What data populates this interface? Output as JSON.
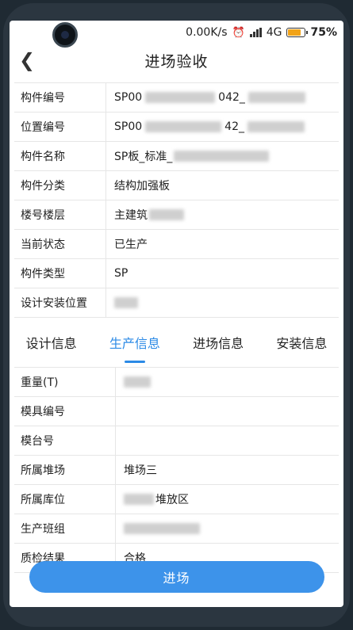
{
  "status": {
    "speed": "0.00K/s",
    "network": "4G",
    "battery": "75%"
  },
  "header": {
    "title": "进场验收"
  },
  "info_rows": [
    {
      "label": "构件编号",
      "value_prefix": "SP00",
      "value_mid": "042_"
    },
    {
      "label": "位置编号",
      "value_prefix": "SP00",
      "value_mid": "42_"
    },
    {
      "label": "构件名称",
      "value_prefix": "SP板_标准_"
    },
    {
      "label": "构件分类",
      "value_prefix": "结构加强板"
    },
    {
      "label": "楼号楼层",
      "value_prefix": "主建筑"
    },
    {
      "label": "当前状态",
      "value_prefix": "已生产"
    },
    {
      "label": "构件类型",
      "value_prefix": "SP"
    },
    {
      "label": "设计安装位置",
      "value_prefix": ""
    }
  ],
  "tabs": [
    "设计信息",
    "生产信息",
    "进场信息",
    "安装信息"
  ],
  "production_rows": [
    {
      "label": "重量(T)",
      "value": ""
    },
    {
      "label": "模具编号",
      "value": ""
    },
    {
      "label": "模台号",
      "value": ""
    },
    {
      "label": "所属堆场",
      "value": "堆场三"
    },
    {
      "label": "所属库位",
      "value": "堆放区"
    },
    {
      "label": "生产班组",
      "value": ""
    },
    {
      "label": "质检结果",
      "value": "合格"
    }
  ],
  "action": {
    "label": "进场"
  },
  "colors": {
    "accent": "#2b8ae6",
    "button": "#3d93ea",
    "battery": "#f2a318"
  }
}
